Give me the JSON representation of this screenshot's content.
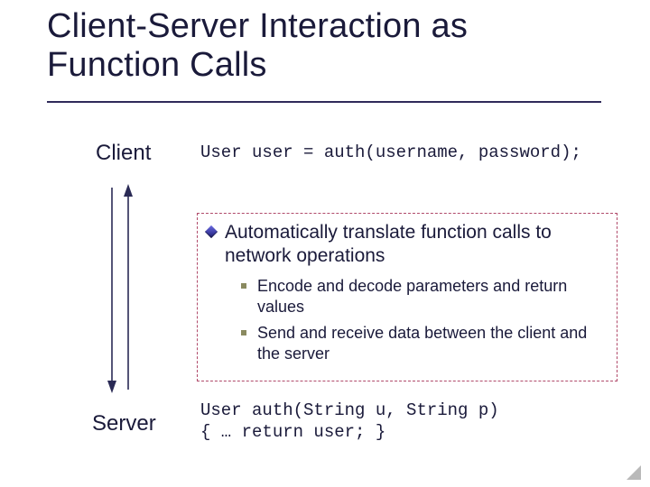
{
  "title": "Client-Server Interaction as Function Calls",
  "client_label": "Client",
  "server_label": "Server",
  "client_code": "User user = auth(username, password);",
  "server_code": "User auth(String u, String p)\n{ … return user; }",
  "callout": {
    "main": "Automatically translate function calls to network operations",
    "subs": [
      "Encode and decode parameters and return values",
      "Send and receive data between the client and the server"
    ]
  }
}
